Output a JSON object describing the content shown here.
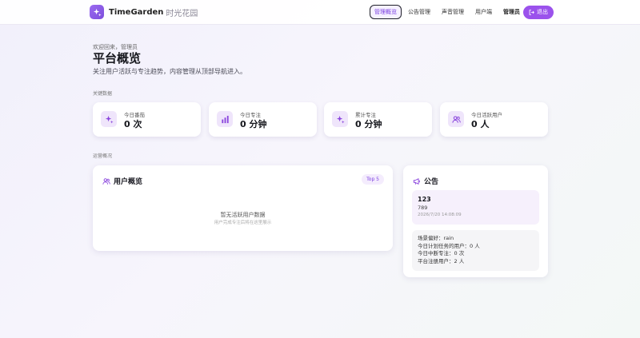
{
  "brand": {
    "name": "TimeGarden",
    "sub": "时光花园"
  },
  "nav": {
    "items": [
      {
        "label": "管理概览",
        "active": true
      },
      {
        "label": "公告管理",
        "active": false
      },
      {
        "label": "声音管理",
        "active": false
      },
      {
        "label": "用户端",
        "active": false
      }
    ],
    "user": "管理员",
    "logout": "退出"
  },
  "header": {
    "welcome": "欢迎回来，管理员",
    "title": "平台概览",
    "subtitle": "关注用户活跃与专注趋势，内容管理从顶部导航进入。"
  },
  "sections": {
    "key_data": "关键数据",
    "operations": "运营概况"
  },
  "stats": [
    {
      "label": "今日番茄",
      "value": "0 次",
      "icon": "sparkle-icon"
    },
    {
      "label": "今日专注",
      "value": "0 分钟",
      "icon": "bar-chart-icon"
    },
    {
      "label": "累计专注",
      "value": "0 分钟",
      "icon": "sparkle-icon"
    },
    {
      "label": "今日活跃用户",
      "value": "0 人",
      "icon": "users-icon"
    }
  ],
  "user_overview": {
    "title": "用户概览",
    "badge": "Top 5",
    "empty_title": "暂无活跃用户数据",
    "empty_sub": "用户完成专注后将在这里展示"
  },
  "notices": {
    "title": "公告",
    "item": {
      "title": "123",
      "body": "789",
      "time": "2026/7/20 14:08:09"
    },
    "stats": [
      "场景偏好：rain",
      "今日计划任务的用户：0 人",
      "今日中断专注：0 次",
      "平台注册用户：2 人"
    ]
  },
  "colors": {
    "accent": "#9b52ec",
    "accent_light": "#efe5fb"
  }
}
